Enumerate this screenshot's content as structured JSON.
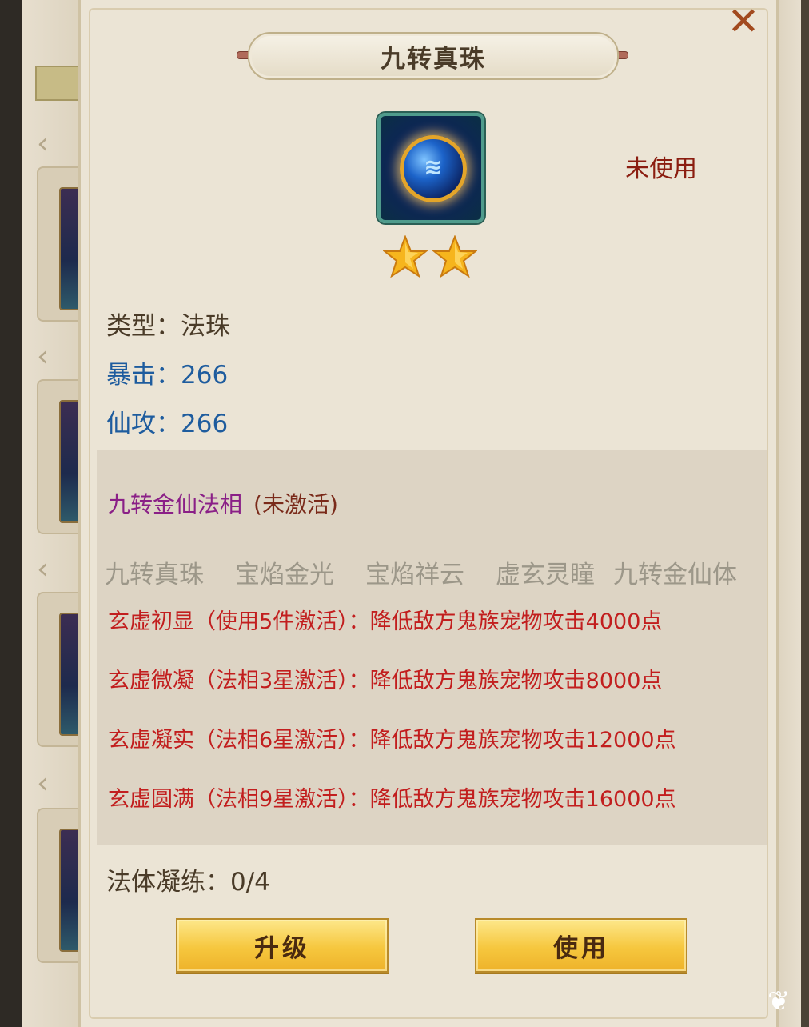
{
  "dialog": {
    "title": "九转真珠",
    "close_icon": "close-icon",
    "status": "未使用",
    "item_icon": "blue-pearl-icon",
    "star_count": 2
  },
  "attributes": {
    "type_label": "类型：",
    "type_value": "法珠",
    "crit_label": "暴击：",
    "crit_value": "266",
    "atk_label": "仙攻：",
    "atk_value": "266"
  },
  "set": {
    "name": "九转金仙法相",
    "state": "(未激活)",
    "pieces": [
      "九转真珠",
      "宝焰金光",
      "宝焰祥云",
      "虚玄灵瞳",
      "九转金仙体"
    ],
    "effects": [
      "玄虚初显（使用5件激活）：降低敌方鬼族宠物攻击4000点",
      "玄虚微凝（法相3星激活）：降低敌方鬼族宠物攻击8000点",
      "玄虚凝实（法相6星激活）：降低敌方鬼族宠物攻击12000点",
      "玄虚圆满（法相9星激活）：降低敌方鬼族宠物攻击16000点"
    ]
  },
  "refine": {
    "label": "法体凝练：",
    "value": "0/4"
  },
  "buttons": {
    "upgrade": "升级",
    "use": "使用"
  },
  "colors": {
    "effect_red": "#c21e1e",
    "attr_blue": "#1e5c9e",
    "set_purple": "#8a1f87",
    "status_red": "#8b1d10",
    "button_gold": "#f6c73e"
  }
}
